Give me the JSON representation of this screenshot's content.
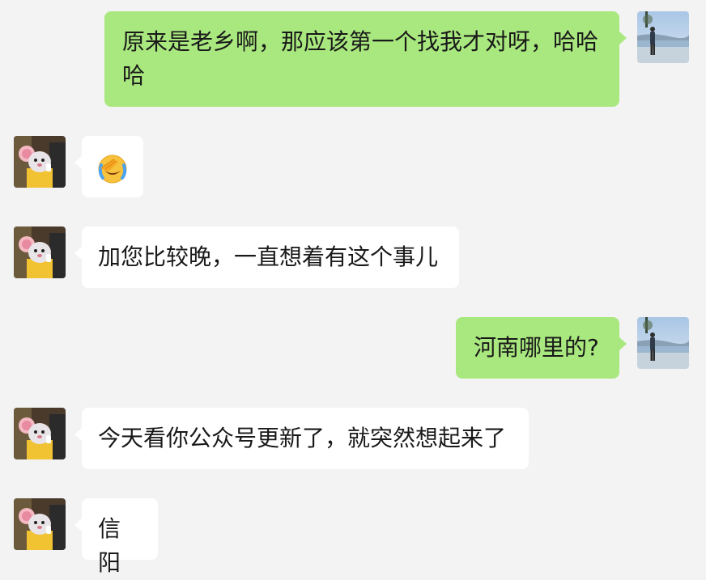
{
  "messages": [
    {
      "side": "right",
      "text": "原来是老乡啊，那应该第一个找我才对呀，哈哈哈"
    },
    {
      "side": "left",
      "emoji": "face-palm-laughing-emoji"
    },
    {
      "side": "left",
      "text": "加您比较晚，一直想着有这个事儿"
    },
    {
      "side": "right",
      "text": "河南哪里的?"
    },
    {
      "side": "left",
      "text": "今天看你公众号更新了，就突然想起来了"
    },
    {
      "side": "left",
      "text": "信阳"
    }
  ],
  "colors": {
    "background": "#f3f3f3",
    "sent_bubble": "#a9e87f",
    "received_bubble": "#ffffff",
    "text": "#191919"
  }
}
